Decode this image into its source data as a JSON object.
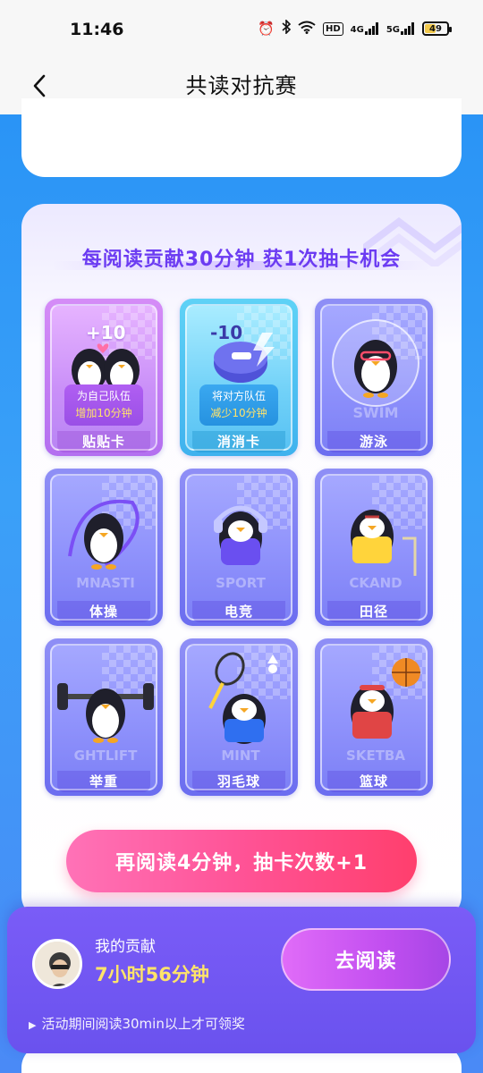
{
  "status_bar": {
    "time": "11:46",
    "hd_label": "HD",
    "sim1": "4G",
    "sim2": "5G",
    "battery_level": "49"
  },
  "nav": {
    "title": "共读对抗赛"
  },
  "cards_section": {
    "headline": "每阅读贡献30分钟 获1次抽卡机会",
    "cards": [
      {
        "label": "贴贴卡",
        "badge": "+10",
        "desc_line1": "为自己队伍",
        "desc_line2": "增加10分钟",
        "style": "pink"
      },
      {
        "label": "消消卡",
        "badge": "-10",
        "desc_line1": "将对方队伍",
        "desc_line2": "减少10分钟",
        "style": "cyan"
      },
      {
        "label": "游泳",
        "bg_text": "SWIM",
        "style": "blue"
      },
      {
        "label": "体操",
        "bg_text": "MNASTI",
        "style": "blue"
      },
      {
        "label": "电竞",
        "bg_text": "SPORT",
        "style": "blue"
      },
      {
        "label": "田径",
        "bg_text": "CKAND",
        "style": "blue"
      },
      {
        "label": "举重",
        "bg_text": "GHTLIFT",
        "style": "blue"
      },
      {
        "label": "羽毛球",
        "bg_text": "MINT",
        "style": "blue"
      },
      {
        "label": "篮球",
        "bg_text": "SKETBA",
        "style": "blue"
      }
    ],
    "cta": "再阅读4分钟，抽卡次数+1"
  },
  "bottom_panel": {
    "contribution_label": "我的贡献",
    "contribution_value": "7小时56分钟",
    "go_read_button": "去阅读",
    "notice": "活动期间阅读30min以上才可领奖"
  },
  "colors": {
    "primary_blue": "#2c98f5",
    "title_purple": "#6c3cf2",
    "cta_pink": "#ff5396",
    "panel_purple": "#6a52ee",
    "highlight_yellow": "#ffe46a"
  }
}
